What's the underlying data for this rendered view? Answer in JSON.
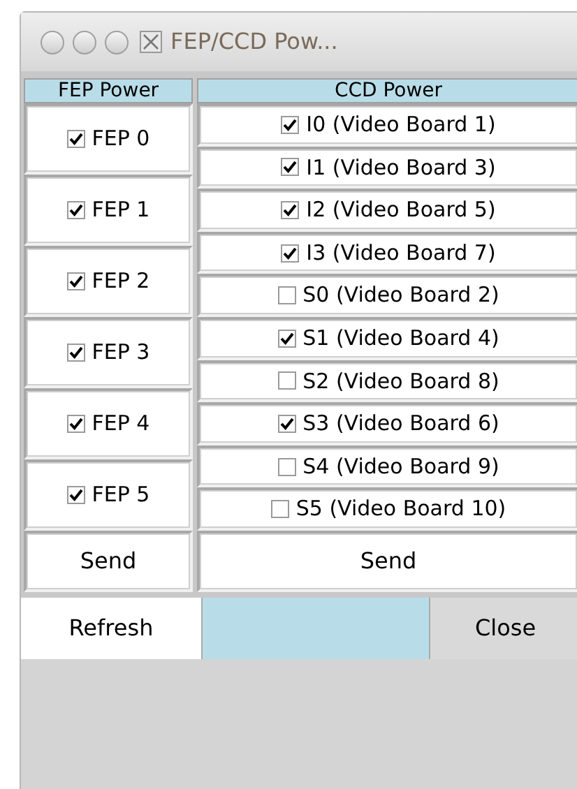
{
  "window": {
    "title": "FEP/CCD Pow..."
  },
  "fep_power": {
    "heading": "FEP Power",
    "items": [
      {
        "label": "FEP 0",
        "checked": true
      },
      {
        "label": "FEP 1",
        "checked": true
      },
      {
        "label": "FEP 2",
        "checked": true
      },
      {
        "label": "FEP 3",
        "checked": true
      },
      {
        "label": "FEP 4",
        "checked": true
      },
      {
        "label": "FEP 5",
        "checked": true
      }
    ],
    "send_button": "Send"
  },
  "ccd_power": {
    "heading": "CCD Power",
    "items": [
      {
        "label": "I0 (Video Board 1)",
        "checked": true
      },
      {
        "label": "I1 (Video Board 3)",
        "checked": true
      },
      {
        "label": "I2 (Video Board 5)",
        "checked": true
      },
      {
        "label": "I3 (Video Board 7)",
        "checked": true
      },
      {
        "label": "S0 (Video Board 2)",
        "checked": false
      },
      {
        "label": "S1 (Video Board 4)",
        "checked": true
      },
      {
        "label": "S2 (Video Board 8)",
        "checked": false
      },
      {
        "label": "S3 (Video Board 6)",
        "checked": true
      },
      {
        "label": "S4 (Video Board 9)",
        "checked": false
      },
      {
        "label": "S5 (Video Board 10)",
        "checked": false
      }
    ],
    "send_button": "Send"
  },
  "buttons": {
    "refresh": "Refresh",
    "close": "Close"
  }
}
